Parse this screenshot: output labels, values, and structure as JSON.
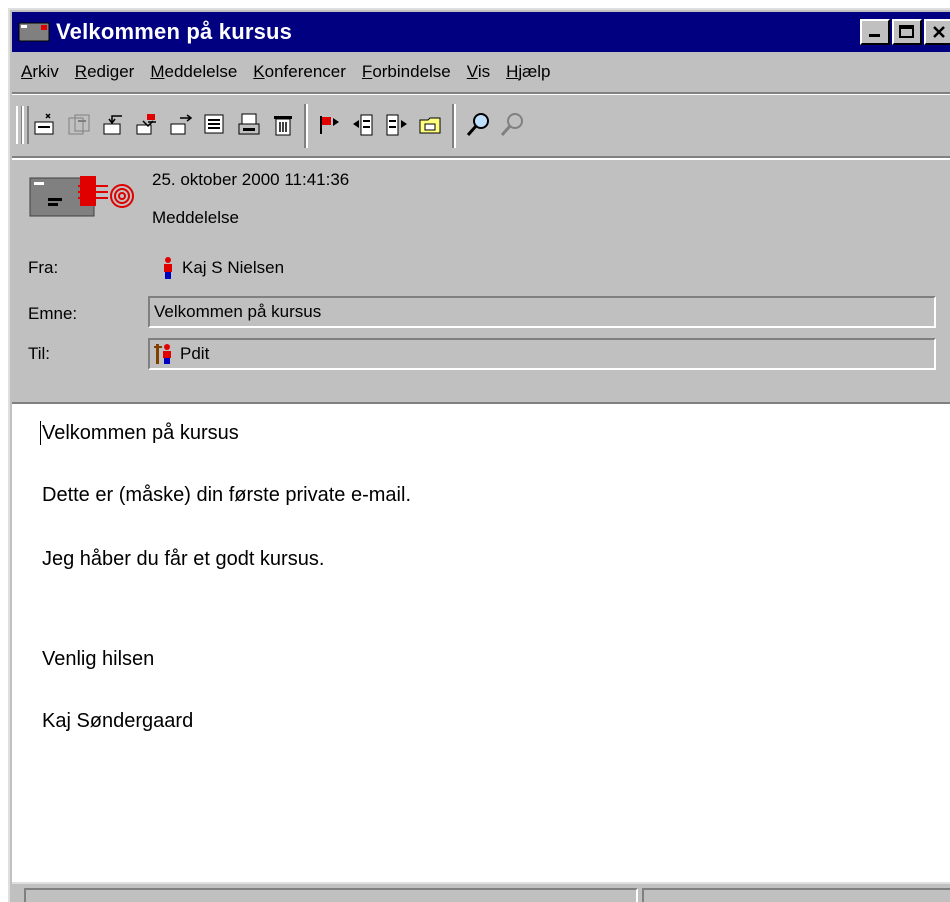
{
  "window": {
    "title": "Velkommen på kursus"
  },
  "menu": [
    {
      "key": "A",
      "rest": "rkiv"
    },
    {
      "key": "R",
      "rest": "ediger"
    },
    {
      "key": "M",
      "rest": "eddelelse"
    },
    {
      "key": "K",
      "rest": "onferencer"
    },
    {
      "key": "F",
      "rest": "orbindelse"
    },
    {
      "key": "V",
      "rest": "is"
    },
    {
      "key": "H",
      "rest": "jælp"
    }
  ],
  "message": {
    "date": "25. oktober 2000 11:41:36",
    "type": "Meddelelse",
    "from_label": "Fra:",
    "from_value": "Kaj S Nielsen",
    "subject_label": "Emne:",
    "subject_value": "Velkommen på kursus",
    "to_label": "Til:",
    "to_value": "Pdit"
  },
  "body": {
    "line1": "Velkommen på kursus",
    "line2": "Dette er (måske) din første private e-mail.",
    "line3": "Jeg håber du får et godt kursus.",
    "line4": "Venlig hilsen",
    "line5": "Kaj Søndergaard"
  },
  "colors": {
    "titlebar": "#000080",
    "face": "#c0c0c0",
    "red_icon": "#e00000"
  }
}
